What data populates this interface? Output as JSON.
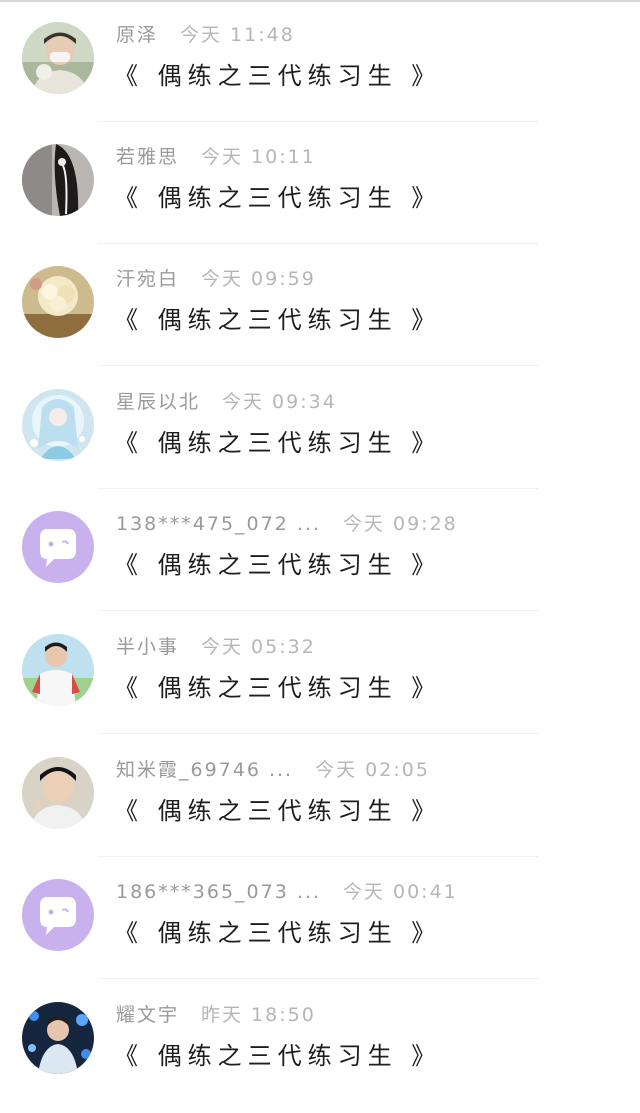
{
  "colors": {
    "name_text": "#9a9a9a",
    "time_text": "#b6b6b6",
    "message_text": "#1e1e1e",
    "default_avatar_bg": "#c9b1ee",
    "divider": "#f0f0f0"
  },
  "messages": [
    {
      "name": "原泽",
      "time": "今天 11:48",
      "text": "《 偶练之三代练习生 》",
      "avatar": "photo-avatar-boy-mask"
    },
    {
      "name": "若雅思",
      "time": "今天 10:11",
      "text": "《 偶练之三代练习生 》",
      "avatar": "photo-avatar-dark-hair"
    },
    {
      "name": "汗宛白",
      "time": "今天 09:59",
      "text": "《 偶练之三代练习生 》",
      "avatar": "photo-avatar-flower"
    },
    {
      "name": "星辰以北",
      "time": "今天 09:34",
      "text": "《 偶练之三代练习生 》",
      "avatar": "photo-avatar-anime-girl"
    },
    {
      "name": "138***475_072 ...",
      "time": "今天 09:28",
      "text": "《 偶练之三代练习生 》",
      "avatar": "default-chat-avatar-icon"
    },
    {
      "name": "半小事",
      "time": "今天 05:32",
      "text": "《 偶练之三代练习生 》",
      "avatar": "photo-avatar-boy-raglan"
    },
    {
      "name": "知米霞_69746 ...",
      "time": "今天 02:05",
      "text": "《 偶练之三代练习生 》",
      "avatar": "photo-avatar-boy-peace"
    },
    {
      "name": "186***365_073 ...",
      "time": "今天 00:41",
      "text": "《 偶练之三代练习生 》",
      "avatar": "default-chat-avatar-icon"
    },
    {
      "name": "耀文宇",
      "time": "昨天 18:50",
      "text": "《 偶练之三代练习生 》",
      "avatar": "photo-avatar-stage-lights"
    }
  ]
}
